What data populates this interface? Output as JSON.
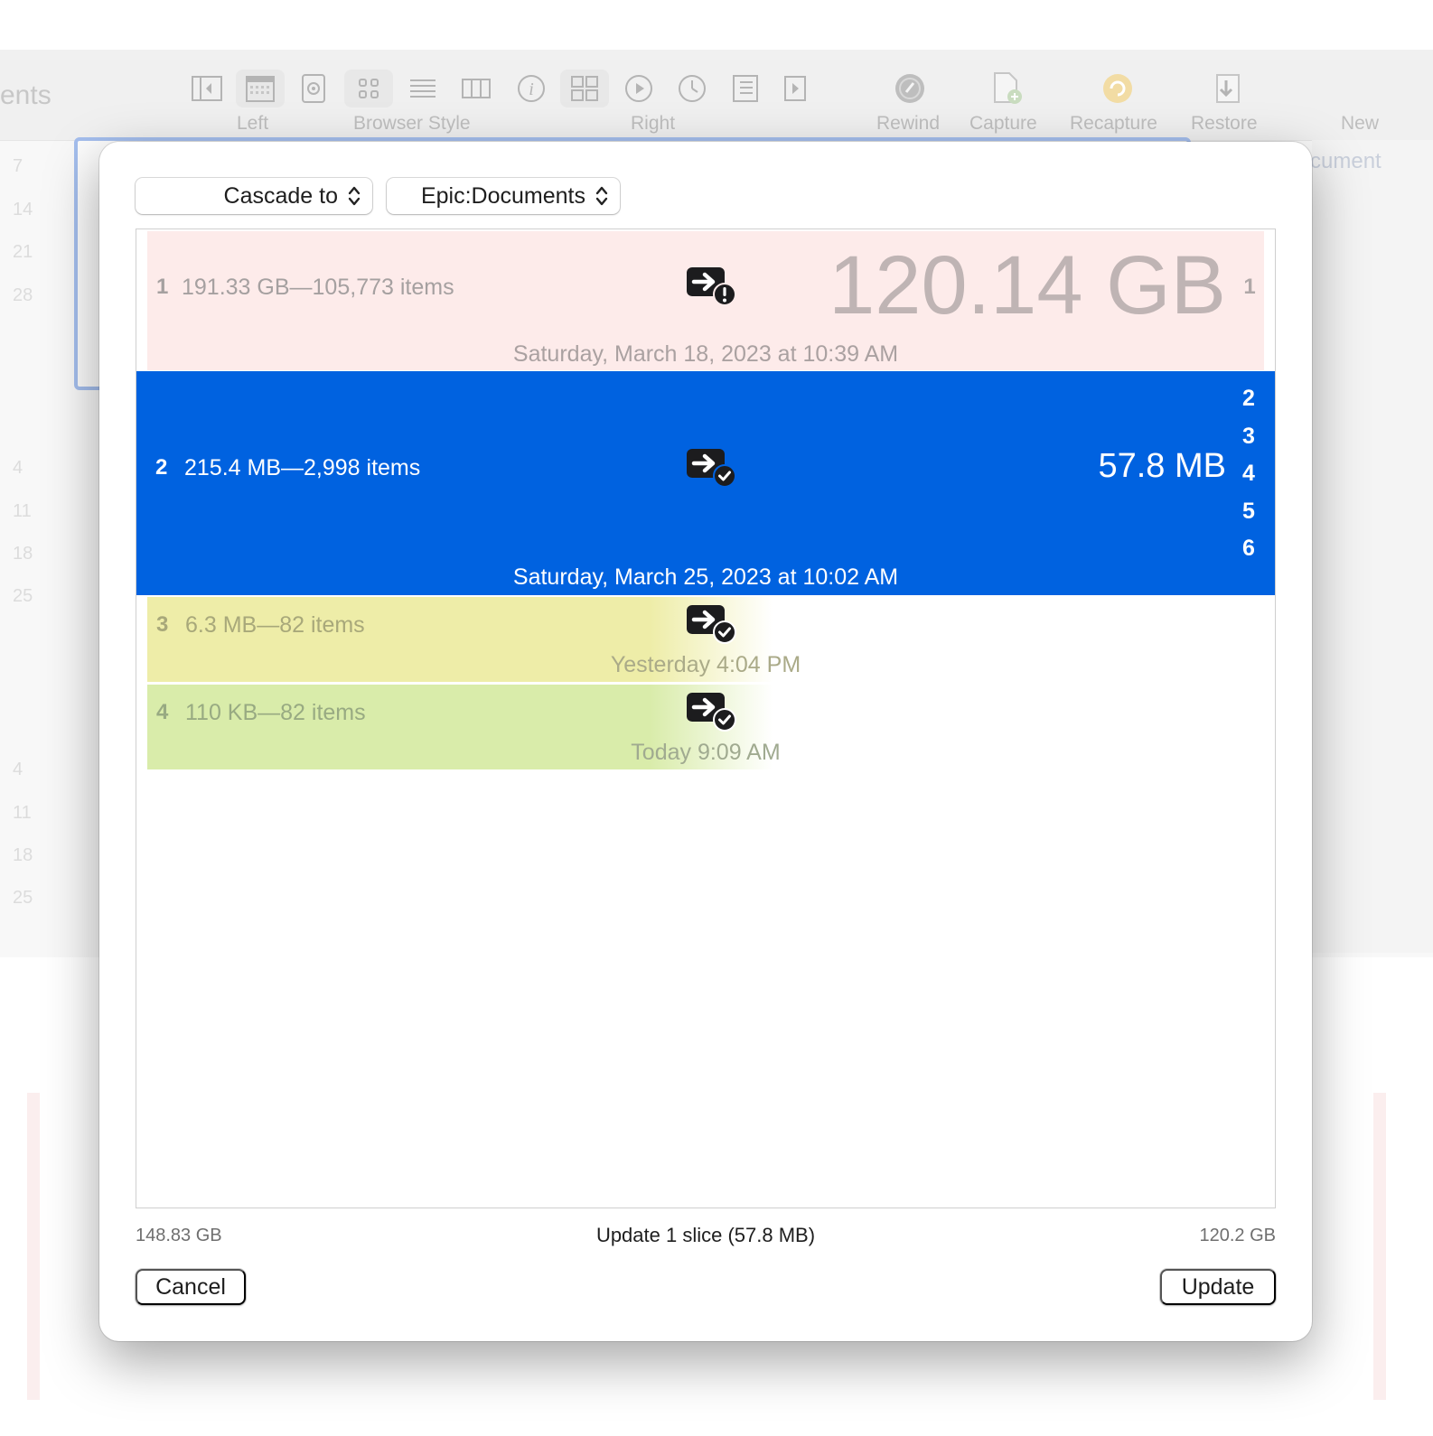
{
  "background": {
    "title_fragment": "ents",
    "toolbar_labels": [
      "Left",
      "Browser Style",
      "Right",
      "Rewind",
      "Capture",
      "Recapture",
      "Restore",
      "New"
    ],
    "right_fragment": "cument",
    "side_numbers": [
      "7",
      "14",
      "21",
      "28",
      "4",
      "11",
      "18",
      "25",
      "4",
      "11",
      "18",
      "25"
    ]
  },
  "header": {
    "mode_popup": "Cascade to",
    "target_popup": "Epic:Documents"
  },
  "rows": [
    {
      "number": "1",
      "summary": "191.33 GB—105,773 items",
      "size": "120.14 GB",
      "slices": [
        "1"
      ],
      "date": "Saturday, March 18, 2023 at 10:39 AM",
      "status_icon": "warning-icon",
      "color": "#fdebea"
    },
    {
      "number": "2",
      "summary": "215.4 MB—2,998 items",
      "size": "57.8 MB",
      "slices": [
        "2",
        "3",
        "4",
        "5",
        "6"
      ],
      "date": "Saturday, March 25, 2023 at 10:02 AM",
      "status_icon": "check-icon",
      "color": "#0062e0"
    },
    {
      "number": "3",
      "summary": "6.3 MB—82 items",
      "date": "Yesterday 4:04 PM",
      "status_icon": "check-icon",
      "color": "#eeeda8"
    },
    {
      "number": "4",
      "summary": "110 KB—82 items",
      "date": "Today 9:09 AM",
      "status_icon": "check-icon",
      "color": "#d9ecaa"
    }
  ],
  "footer": {
    "left_total": "148.83 GB",
    "status": "Update 1 slice (57.8 MB)",
    "right_total": "120.2 GB",
    "cancel_label": "Cancel",
    "update_label": "Update"
  }
}
